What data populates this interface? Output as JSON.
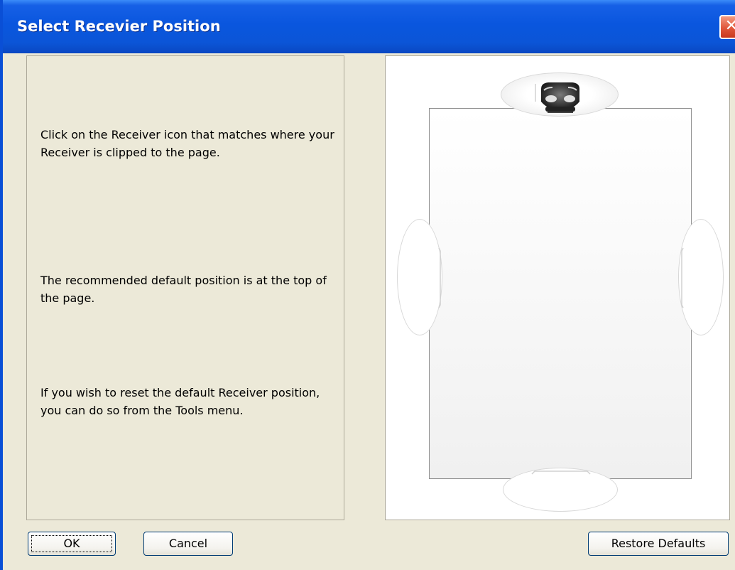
{
  "window": {
    "title": "Select Recevier Position",
    "close_symbol": "✕"
  },
  "instructions": {
    "paragraph1": "Click on the Receiver icon that matches where your Receiver is clipped to the page.",
    "paragraph2": "The recommended default position is at the top of the page.",
    "paragraph3": "If you wish to reset the default Receiver position, you can do so from the Tools menu."
  },
  "preview": {
    "receivers": [
      "top",
      "left",
      "right",
      "bottom"
    ],
    "selected_receiver": "top",
    "icon": "receiver-device-icon"
  },
  "buttons": {
    "ok": "OK",
    "cancel": "Cancel",
    "restore_defaults": "Restore Defaults"
  },
  "colors": {
    "titlebar": "#0a56de",
    "face": "#ece9d8",
    "close": "#e0573b"
  }
}
